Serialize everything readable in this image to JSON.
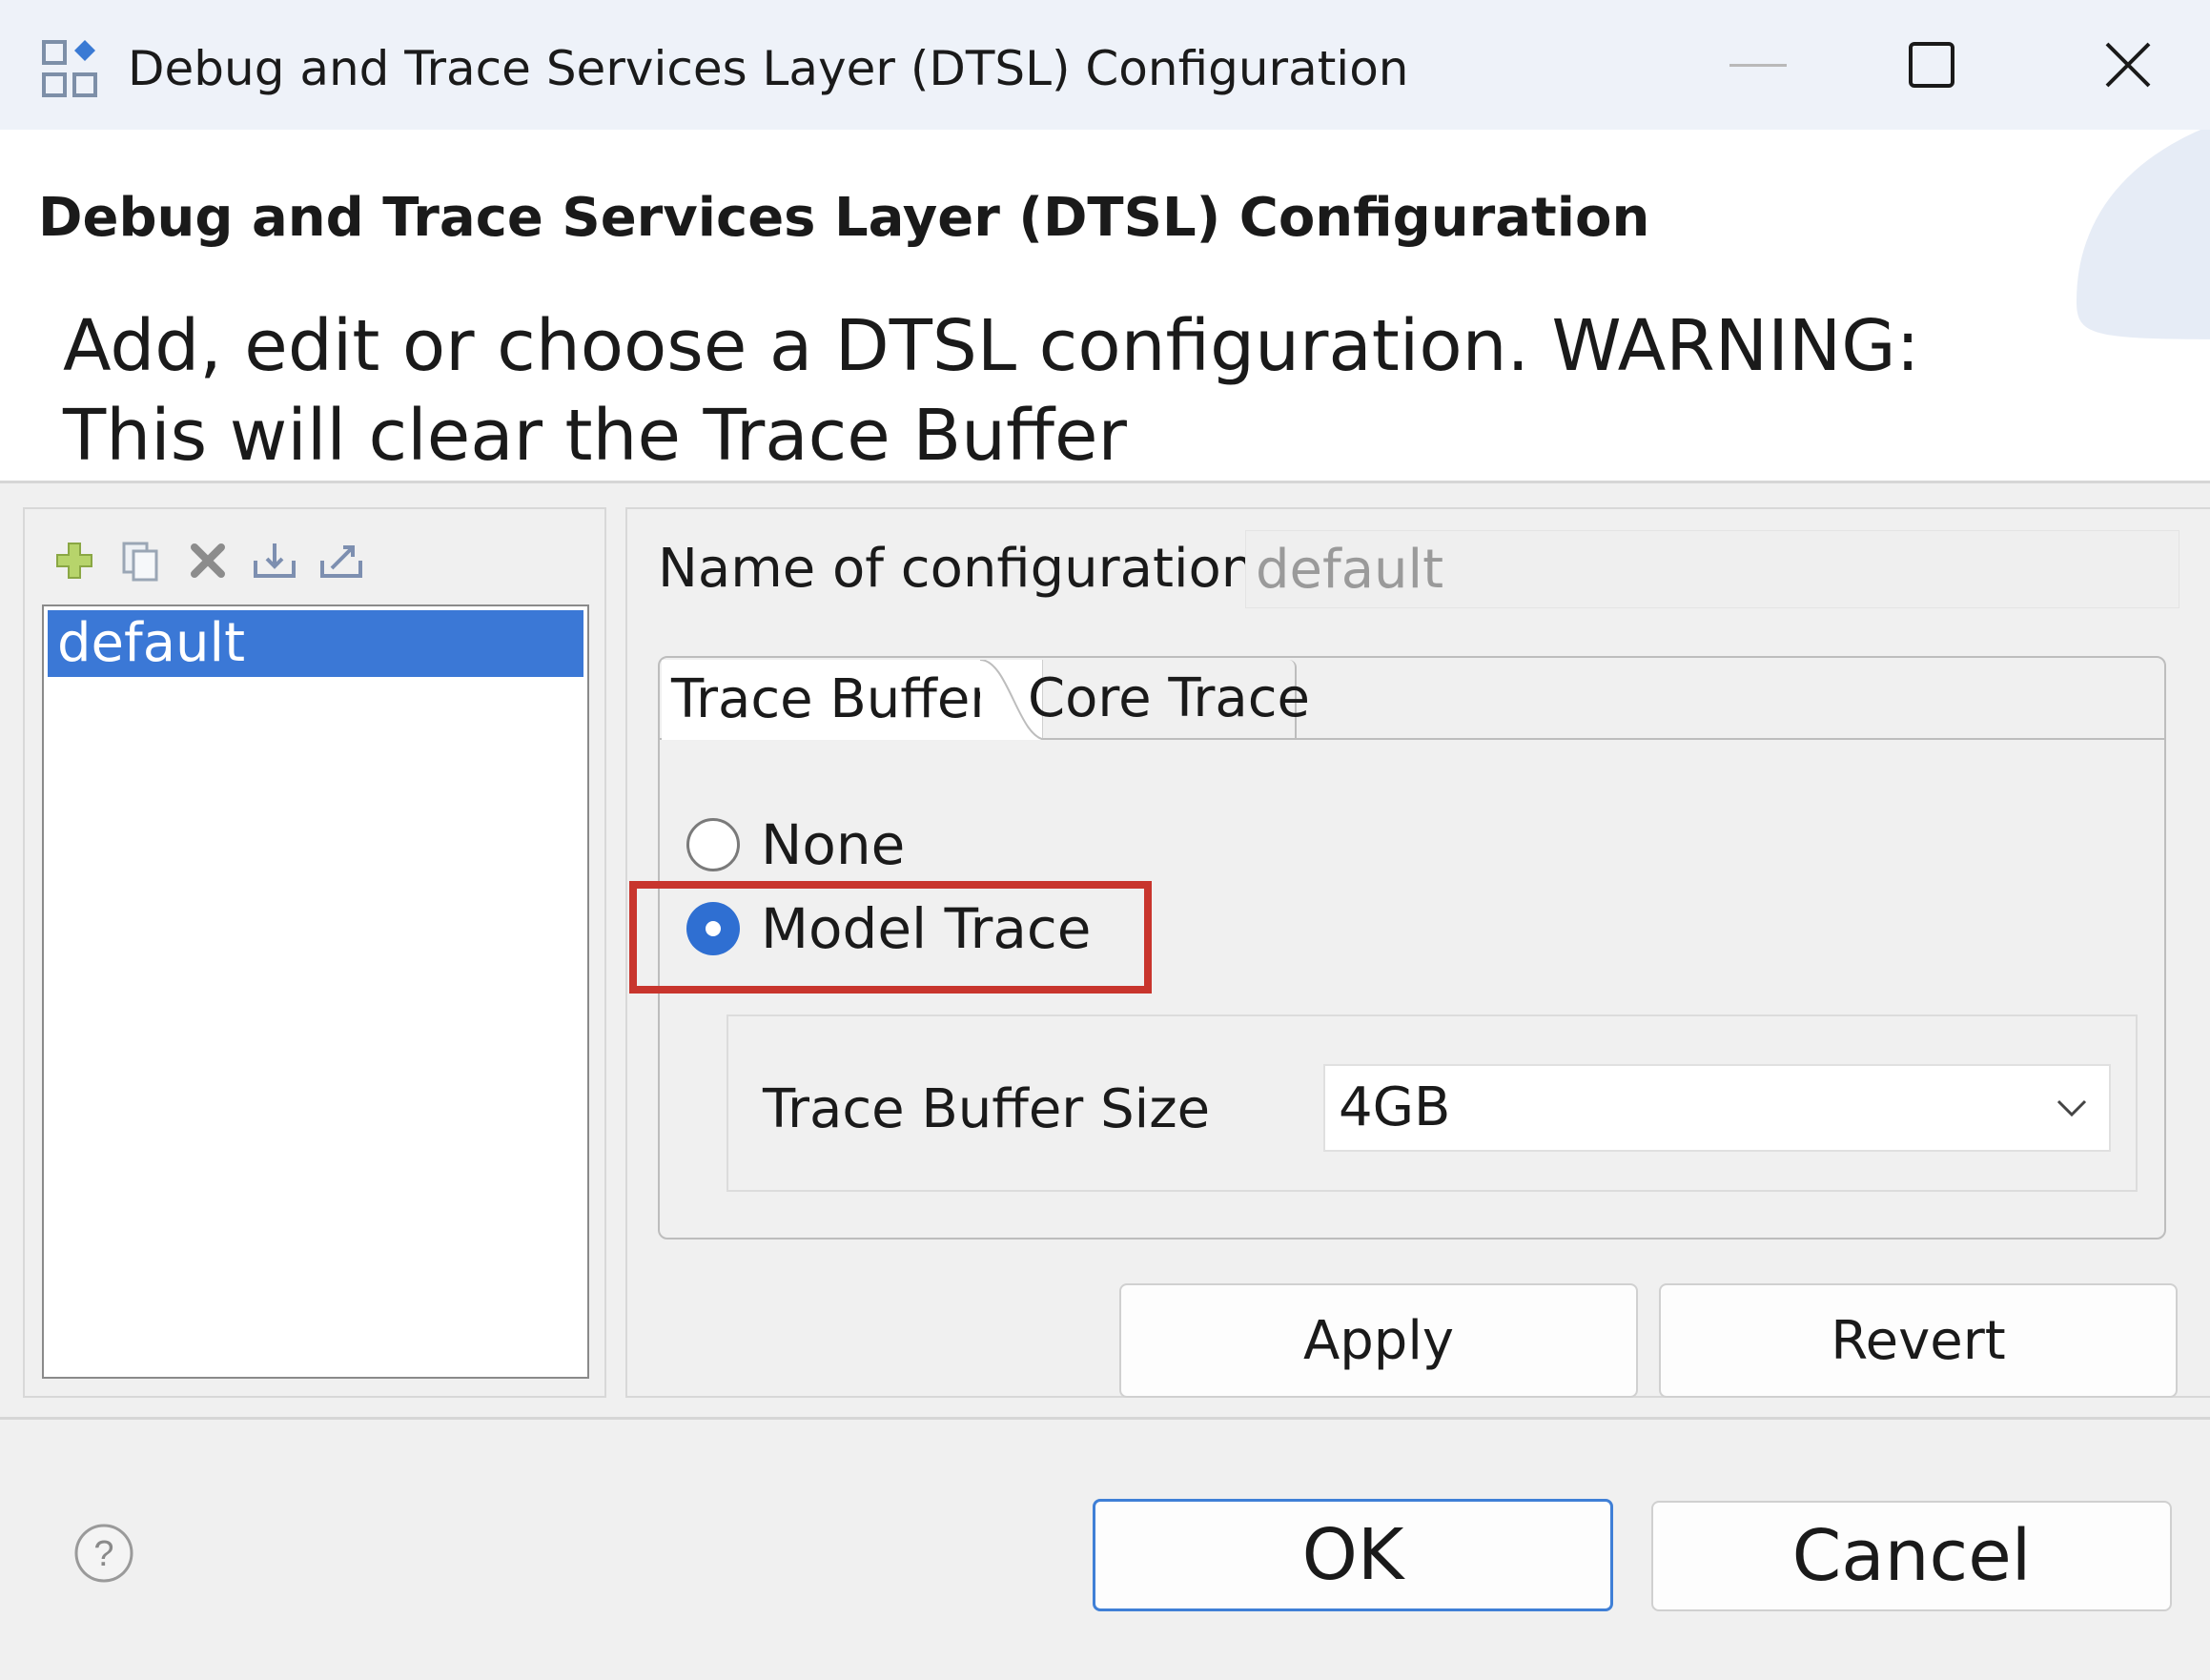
{
  "window": {
    "title": "Debug and Trace Services Layer (DTSL) Configuration",
    "controls": {
      "minimize": "minimize-icon",
      "maximize": "maximize-icon",
      "close": "close-icon"
    }
  },
  "header": {
    "title": "Debug and Trace Services Layer (DTSL) Configuration",
    "description": "Add, edit or choose a DTSL configuration.  WARNING: This will clear the Trace Buffer"
  },
  "toolbar": {
    "icons": [
      "add-icon",
      "copy-icon",
      "delete-icon",
      "import-icon",
      "export-icon"
    ]
  },
  "configurations": {
    "items": [
      "default"
    ],
    "selected": "default"
  },
  "config_form": {
    "name_label": "Name of configuration:",
    "name_value": "default"
  },
  "tabs": [
    {
      "label": "Trace Buffer",
      "active": true
    },
    {
      "label": "Core Trace",
      "active": false
    }
  ],
  "trace_buffer": {
    "options": [
      {
        "label": "None",
        "selected": false
      },
      {
        "label": "Model Trace",
        "selected": true
      }
    ],
    "size_label": "Trace Buffer Size",
    "size_value": "4GB"
  },
  "actions": {
    "apply": "Apply",
    "revert": "Revert"
  },
  "footer": {
    "ok": "OK",
    "cancel": "Cancel",
    "help_icon": "help-icon"
  },
  "colors": {
    "selection": "#3b78d6",
    "radio_selected": "#2f6fd2",
    "highlight": "#c8352d",
    "default_button_border": "#3f7fd6"
  }
}
